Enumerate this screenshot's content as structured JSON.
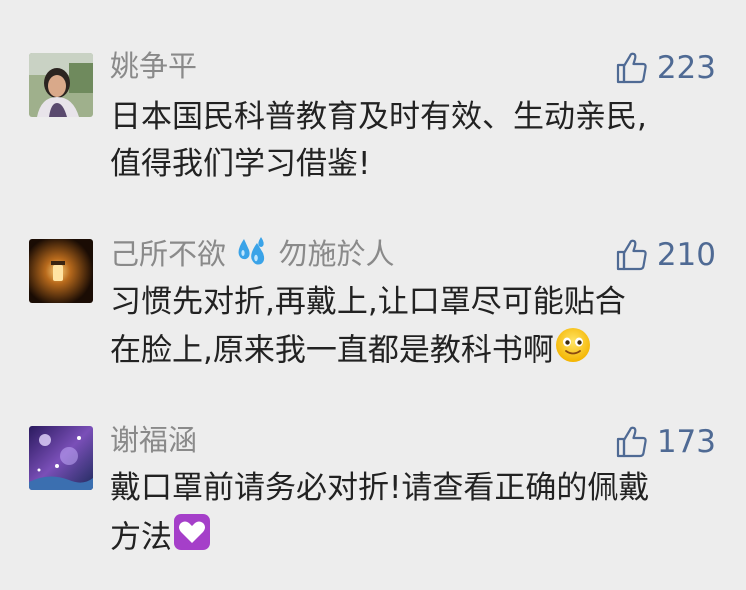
{
  "comments": [
    {
      "name": "姚争平",
      "likes": "223",
      "text_lines": [
        "日本国民科普教育及时有效、生动亲民,",
        "值得我们学习借鉴!"
      ]
    },
    {
      "name_part1": "己所不欲",
      "name_emoji": "sweat-droplets-icon",
      "name_part2": "勿施於人",
      "likes": "210",
      "text_lines": [
        "习惯先对折,再戴上,让口罩尽可能贴合",
        "在脸上,原来我一直都是教科书啊"
      ],
      "trailing_emoji": "smiling-face-icon"
    },
    {
      "name": "谢福涵",
      "likes": "173",
      "text_lines": [
        "戴口罩前请务必对折!请查看正确的佩戴",
        "方法"
      ],
      "trailing_emoji": "purple-heart-icon"
    }
  ],
  "colors": {
    "background": "#ededed",
    "name_gray": "#8a8a8a",
    "like_blue": "#4f6a94",
    "text_dark": "#222222"
  }
}
